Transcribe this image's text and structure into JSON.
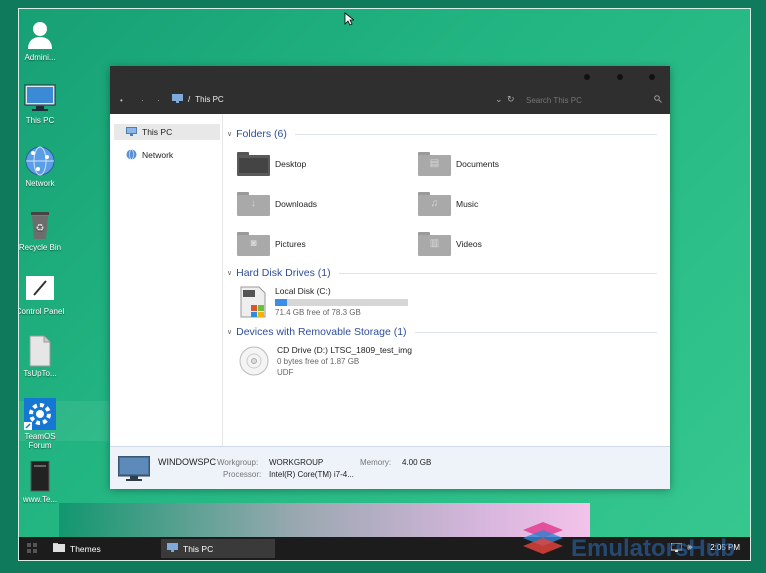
{
  "desktop": {
    "icons": [
      {
        "label": "Admini...",
        "icon": "user-icon"
      },
      {
        "label": "This PC",
        "icon": "monitor-icon"
      },
      {
        "label": "Network",
        "icon": "globe-icon"
      },
      {
        "label": "Recycle Bin",
        "icon": "recycle-bin-icon"
      },
      {
        "label": "Control Panel",
        "icon": "control-panel-icon"
      },
      {
        "label": "TsUpTo...",
        "icon": "document-icon"
      },
      {
        "label": "TeamOS Forum",
        "icon": "gear-icon"
      },
      {
        "label": "www.Te...",
        "icon": "dark-file-icon"
      }
    ]
  },
  "explorer": {
    "breadcrumb": {
      "sep": "/",
      "location": "This PC"
    },
    "search_placeholder": "Search This PC",
    "nav": [
      {
        "label": "This PC",
        "icon": "monitor-icon",
        "selected": true
      },
      {
        "label": "Network",
        "icon": "globe-icon",
        "selected": false
      }
    ],
    "groups": {
      "folders_title": "Folders (6)",
      "drives_title": "Hard Disk Drives (1)",
      "removable_title": "Devices with Removable Storage (1)"
    },
    "folders": [
      {
        "name": "Desktop",
        "icon": "desktop-folder-icon"
      },
      {
        "name": "Documents",
        "icon": "documents-folder-icon"
      },
      {
        "name": "Downloads",
        "icon": "downloads-folder-icon"
      },
      {
        "name": "Music",
        "icon": "music-folder-icon"
      },
      {
        "name": "Pictures",
        "icon": "pictures-folder-icon"
      },
      {
        "name": "Videos",
        "icon": "videos-folder-icon"
      }
    ],
    "drives": [
      {
        "name": "Local Disk (C:)",
        "free": "71.4 GB free of 78.3 GB",
        "used_fraction": 0.088,
        "icon": "hard-disk-icon"
      }
    ],
    "removable": [
      {
        "name": "CD Drive (D:) LTSC_1809_test_img",
        "free": "0 bytes free of 1.87 GB",
        "fs": "UDF",
        "icon": "cd-drive-icon"
      }
    ],
    "details": {
      "pc_name": "WINDOWSPC",
      "workgroup_label": "Workgroup:",
      "workgroup": "WORKGROUP",
      "memory_label": "Memory:",
      "memory": "4.00 GB",
      "processor_label": "Processor:",
      "processor": "Intel(R) Core(TM) i7-4..."
    }
  },
  "taskbar": {
    "items": [
      {
        "label": "Themes",
        "icon": "folder-icon"
      },
      {
        "label": "This PC",
        "icon": "monitor-icon"
      }
    ],
    "clock": "2:05 PM"
  },
  "watermark": {
    "text": "EmulatorsHub"
  },
  "colors": {
    "accent": "#2e4e9a",
    "disk_bar": "#3a8ee6",
    "desktop": "#22b582",
    "titlebar": "#2f2f2f"
  }
}
